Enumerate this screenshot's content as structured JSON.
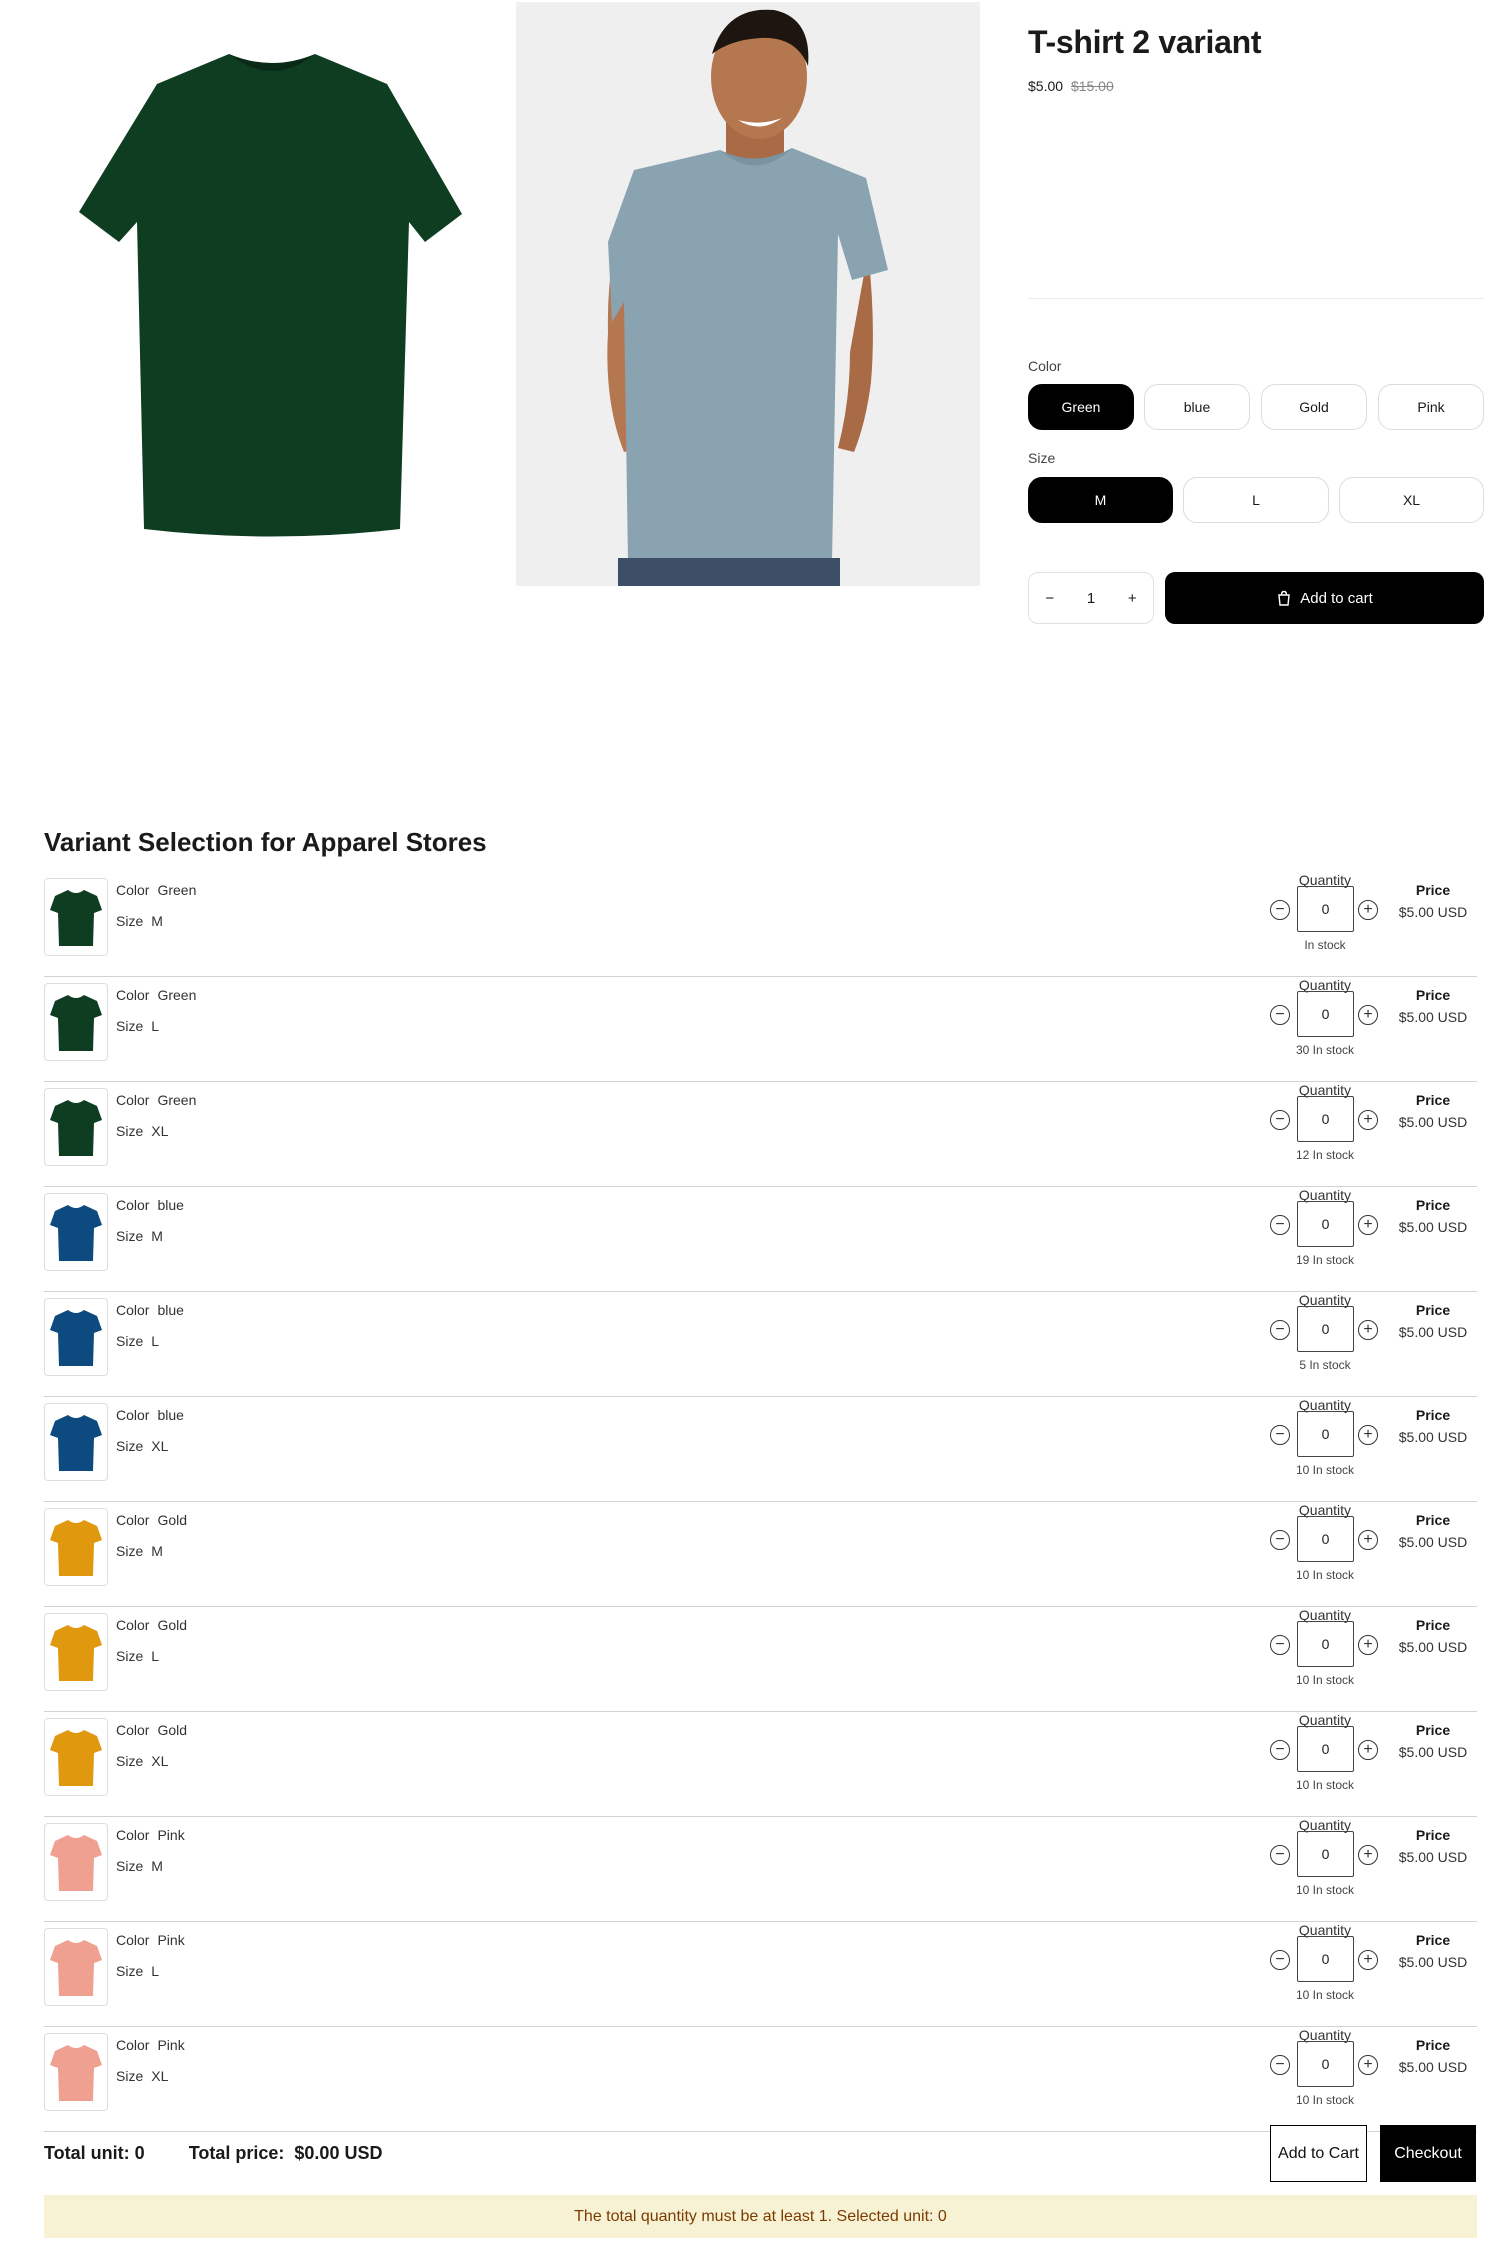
{
  "product": {
    "title": "T-shirt 2 variant",
    "price": "$5.00",
    "compare_price": "$15.00",
    "color_label": "Color",
    "colors": [
      "Green",
      "blue",
      "Gold",
      "Pink"
    ],
    "selected_color": "Green",
    "size_label": "Size",
    "sizes": [
      "M",
      "L",
      "XL"
    ],
    "selected_size": "M",
    "quantity": "1",
    "add_to_cart_label": "Add to cart",
    "minus_symbol": "−",
    "plus_symbol": "+"
  },
  "variants_section": {
    "title": "Variant Selection for Apparel Stores",
    "quantity_label": "Quantity",
    "price_label": "Price",
    "color_key": "Color",
    "size_key": "Size",
    "rows": [
      {
        "color": "Green",
        "size": "M",
        "qty": "0",
        "stock": "In stock",
        "price": "$5.00 USD",
        "swatch": "#0f3d22"
      },
      {
        "color": "Green",
        "size": "L",
        "qty": "0",
        "stock": "30 In stock",
        "price": "$5.00 USD",
        "swatch": "#0f3d22"
      },
      {
        "color": "Green",
        "size": "XL",
        "qty": "0",
        "stock": "12 In stock",
        "price": "$5.00 USD",
        "swatch": "#0f3d22"
      },
      {
        "color": "blue",
        "size": "M",
        "qty": "0",
        "stock": "19 In stock",
        "price": "$5.00 USD",
        "swatch": "#0d4a80"
      },
      {
        "color": "blue",
        "size": "L",
        "qty": "0",
        "stock": "5 In stock",
        "price": "$5.00 USD",
        "swatch": "#0d4a80"
      },
      {
        "color": "blue",
        "size": "XL",
        "qty": "0",
        "stock": "10 In stock",
        "price": "$5.00 USD",
        "swatch": "#0d4a80"
      },
      {
        "color": "Gold",
        "size": "M",
        "qty": "0",
        "stock": "10 In stock",
        "price": "$5.00 USD",
        "swatch": "#e0980f"
      },
      {
        "color": "Gold",
        "size": "L",
        "qty": "0",
        "stock": "10 In stock",
        "price": "$5.00 USD",
        "swatch": "#e0980f"
      },
      {
        "color": "Gold",
        "size": "XL",
        "qty": "0",
        "stock": "10 In stock",
        "price": "$5.00 USD",
        "swatch": "#e0980f"
      },
      {
        "color": "Pink",
        "size": "M",
        "qty": "0",
        "stock": "10 In stock",
        "price": "$5.00 USD",
        "swatch": "#efa090"
      },
      {
        "color": "Pink",
        "size": "L",
        "qty": "0",
        "stock": "10 In stock",
        "price": "$5.00 USD",
        "swatch": "#efa090"
      },
      {
        "color": "Pink",
        "size": "XL",
        "qty": "0",
        "stock": "10 In stock",
        "price": "$5.00 USD",
        "swatch": "#efa090"
      }
    ]
  },
  "footer": {
    "total_unit_label": "Total unit:",
    "total_unit_value": "0",
    "total_price_label": "Total price:",
    "total_price_value": "$0.00 USD",
    "add_to_cart_label": "Add to Cart",
    "checkout_label": "Checkout",
    "notice": "The total quantity must be at least 1. Selected unit: 0"
  },
  "colors": {
    "green_shirt": "#0f3d22",
    "model_shirt": "#8aa3b0",
    "notice_bg": "#f8f2d5",
    "notice_text": "#7a3b00"
  },
  "icons": {
    "cart": "shopping-bag-icon",
    "minus": "minus-circle-icon",
    "plus": "plus-circle-icon"
  }
}
